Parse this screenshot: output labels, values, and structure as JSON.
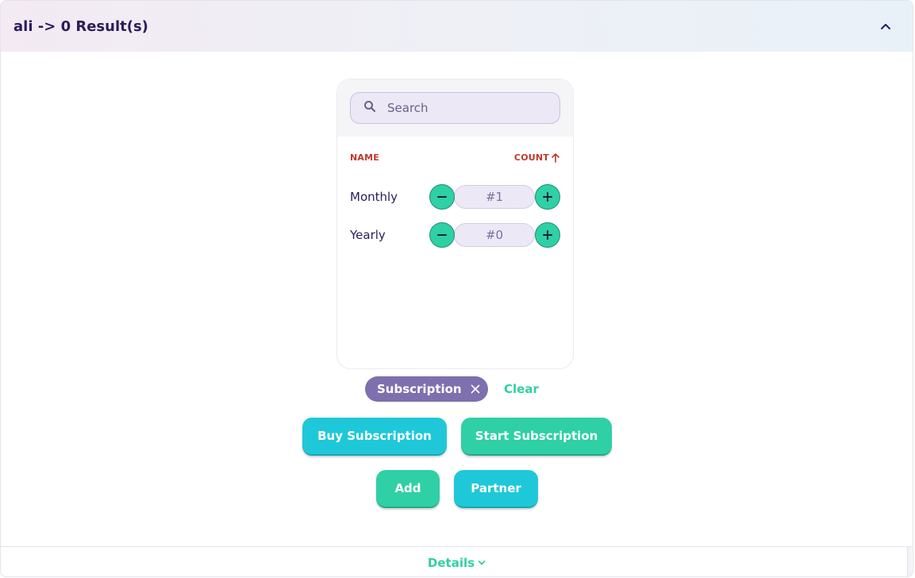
{
  "header": {
    "title": "ali -> 0 Result(s)"
  },
  "search": {
    "placeholder": "Search",
    "value": ""
  },
  "table": {
    "col_name": "NAME",
    "col_count": "COUNT",
    "rows": [
      {
        "label": "Monthly",
        "count": "#1"
      },
      {
        "label": "Yearly",
        "count": "#0"
      }
    ]
  },
  "filter": {
    "chip_label": "Subscription",
    "clear_label": "Clear"
  },
  "actions": {
    "buy_subscription": "Buy Subscription",
    "start_subscription": "Start Subscription",
    "add": "Add",
    "partner": "Partner"
  },
  "footer": {
    "details_label": "Details"
  },
  "colors": {
    "accent_green": "#2fd0a5",
    "accent_cyan": "#1fc8d8",
    "chip_purple": "#7e6fae",
    "title_navy": "#2b1d5a",
    "column_red": "#c0392b"
  }
}
